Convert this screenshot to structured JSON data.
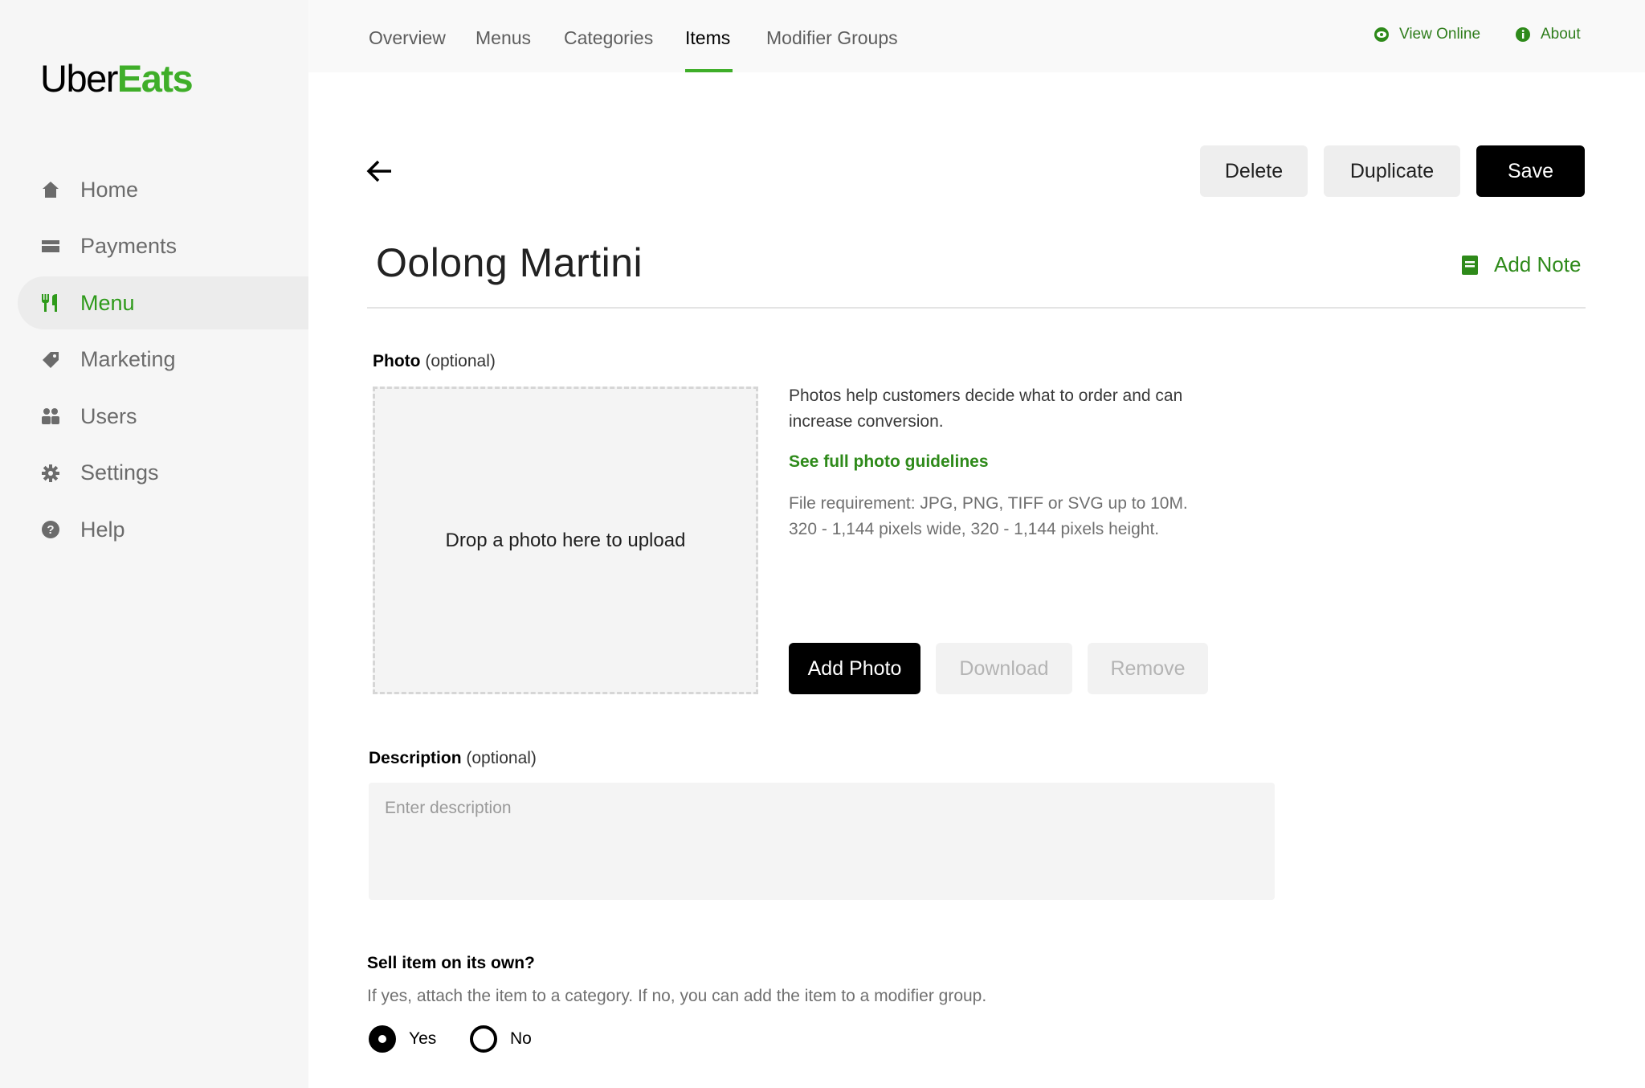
{
  "brand": {
    "part1": "Uber",
    "part2": "Eats"
  },
  "sidebar": {
    "items": [
      {
        "label": "Home",
        "icon": "home-icon"
      },
      {
        "label": "Payments",
        "icon": "card-icon"
      },
      {
        "label": "Menu",
        "icon": "fork-knife-icon",
        "active": true
      },
      {
        "label": "Marketing",
        "icon": "tag-icon"
      },
      {
        "label": "Users",
        "icon": "users-icon"
      },
      {
        "label": "Settings",
        "icon": "gear-icon"
      },
      {
        "label": "Help",
        "icon": "help-icon"
      }
    ]
  },
  "topnav": {
    "tabs": [
      "Overview",
      "Menus",
      "Categories",
      "Items",
      "Modifier Groups"
    ],
    "active_tab": "Items",
    "view_online": "View Online",
    "about": "About"
  },
  "actions": {
    "delete": "Delete",
    "duplicate": "Duplicate",
    "save": "Save"
  },
  "item": {
    "title": "Oolong Martini",
    "add_note": "Add Note"
  },
  "photo": {
    "label": "Photo",
    "optional": "(optional)",
    "drop_text": "Drop a photo here to upload",
    "help_line1": "Photos help customers decide what to order and can",
    "help_line2": "increase conversion.",
    "guidelines_link": "See full photo guidelines",
    "req_line1": "File requirement: JPG, PNG, TIFF or SVG up to 10M.",
    "req_line2": "320 - 1,144 pixels wide, 320 - 1,144 pixels height.",
    "add_photo": "Add Photo",
    "download": "Download",
    "remove": "Remove"
  },
  "description": {
    "label": "Description",
    "optional": "(optional)",
    "placeholder": "Enter description"
  },
  "sell": {
    "label": "Sell item on its own?",
    "sub": "If yes, attach the item to a category. If no, you can add the item to a modifier group.",
    "yes": "Yes",
    "no": "No",
    "selected": "Yes"
  },
  "colors": {
    "accent": "#3fae29",
    "link": "#2e8a1a",
    "dark": "#000000"
  }
}
